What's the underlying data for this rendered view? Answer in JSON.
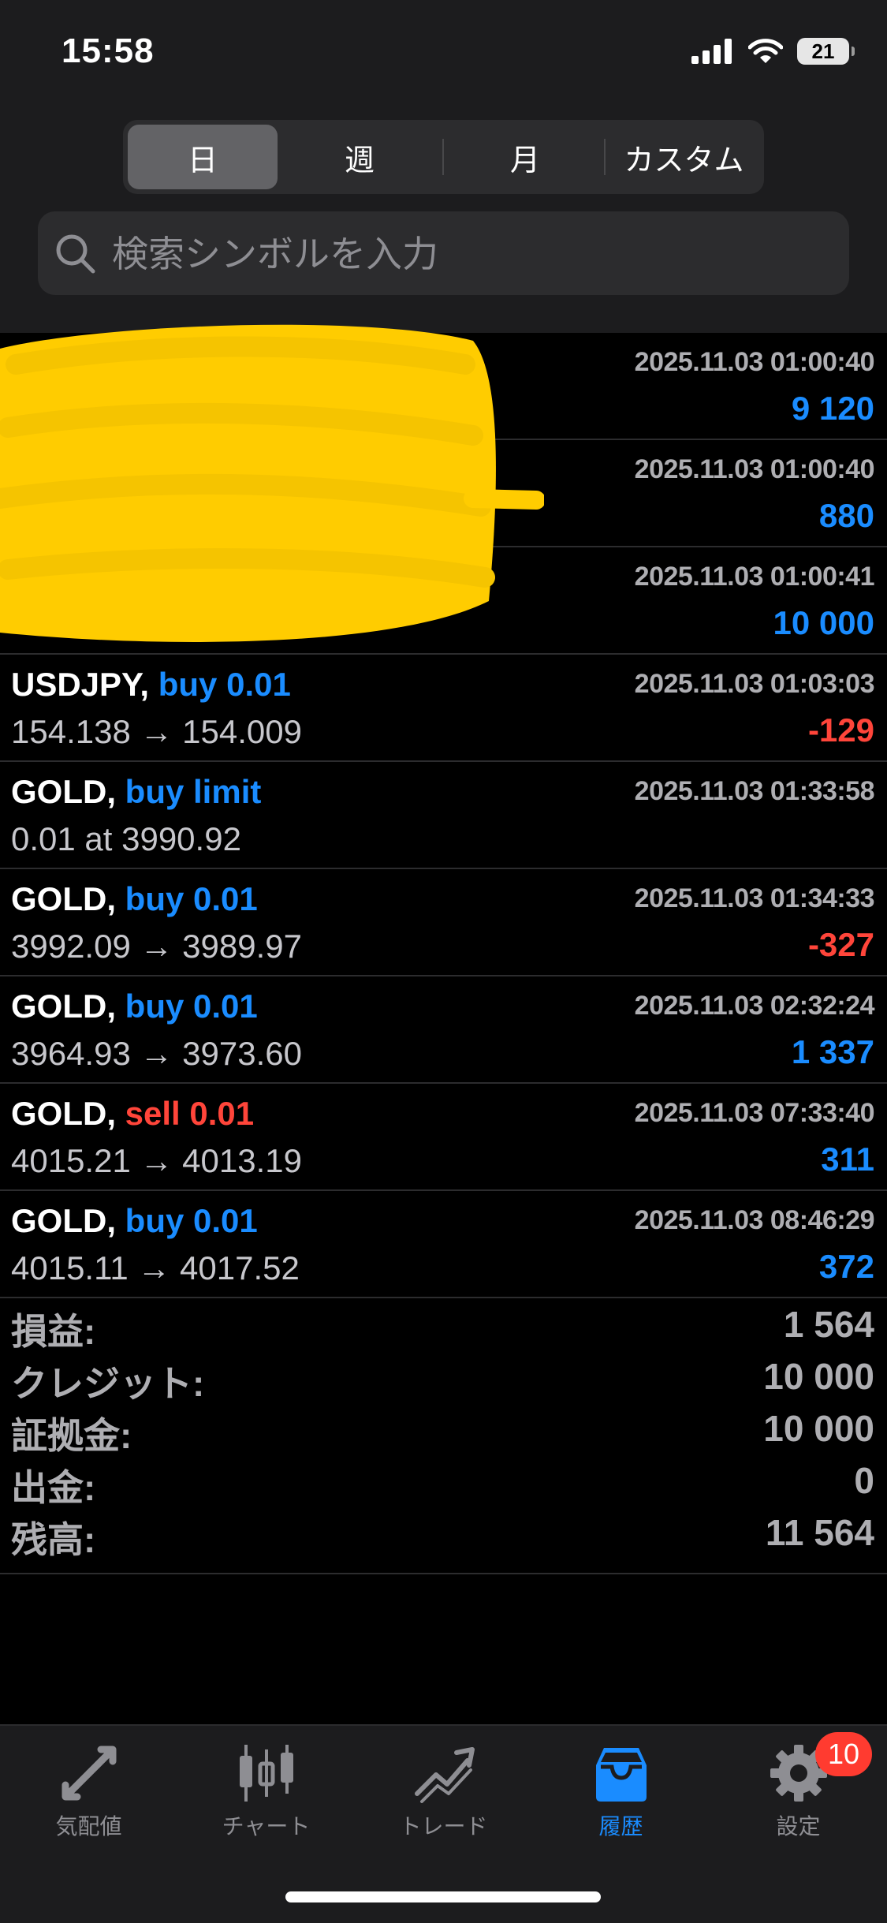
{
  "status_bar": {
    "time": "15:58",
    "battery": "21"
  },
  "segments": [
    "日",
    "週",
    "月",
    "カスタム"
  ],
  "search": {
    "placeholder": "検索シンボルを入力"
  },
  "deals": [
    {
      "symbol": "",
      "action": "",
      "date": "2025.11.03 01:00:40",
      "detail": "",
      "amount": "9 120"
    },
    {
      "symbol": "",
      "action": "",
      "date": "2025.11.03 01:00:40",
      "detail": "",
      "amount": "880"
    },
    {
      "symbol": "",
      "action": "",
      "date": "2025.11.03 01:00:41",
      "detail": "",
      "amount": "10 000"
    },
    {
      "symbol": "USDJPY,",
      "action": "buy 0.01",
      "date": "2025.11.03 01:03:03",
      "detail": "154.138 → 154.009",
      "amount": "-129"
    },
    {
      "symbol": "GOLD,",
      "action": "buy limit",
      "date": "2025.11.03 01:33:58",
      "detail": "0.01 at 3990.92",
      "amount": ""
    },
    {
      "symbol": "GOLD,",
      "action": "buy 0.01",
      "date": "2025.11.03 01:34:33",
      "detail": "3992.09 → 3989.97",
      "amount": "-327"
    },
    {
      "symbol": "GOLD,",
      "action": "buy 0.01",
      "date": "2025.11.03 02:32:24",
      "detail": "3964.93 → 3973.60",
      "amount": "1 337"
    },
    {
      "symbol": "GOLD,",
      "action": "sell 0.01",
      "date": "2025.11.03 07:33:40",
      "detail": "4015.21 → 4013.19",
      "amount": "311"
    },
    {
      "symbol": "GOLD,",
      "action": "buy 0.01",
      "date": "2025.11.03 08:46:29",
      "detail": "4015.11 → 4017.52",
      "amount": "372"
    }
  ],
  "summary": [
    {
      "label": "損益:",
      "value": "1 564"
    },
    {
      "label": "クレジット:",
      "value": "10 000"
    },
    {
      "label": "証拠金:",
      "value": "10 000"
    },
    {
      "label": "出金:",
      "value": "0"
    },
    {
      "label": "残高:",
      "value": "11 564"
    }
  ],
  "tabs": [
    {
      "label": "気配値",
      "icon": "quotes-icon"
    },
    {
      "label": "チャート",
      "icon": "chart-icon"
    },
    {
      "label": "トレード",
      "icon": "trade-icon"
    },
    {
      "label": "履歴",
      "icon": "history-icon"
    },
    {
      "label": "設定",
      "icon": "settings-icon"
    }
  ],
  "settings_badge": "10",
  "colors": {
    "accent": "#1a8cff",
    "negative": "#ff453a",
    "background": "#000000"
  }
}
